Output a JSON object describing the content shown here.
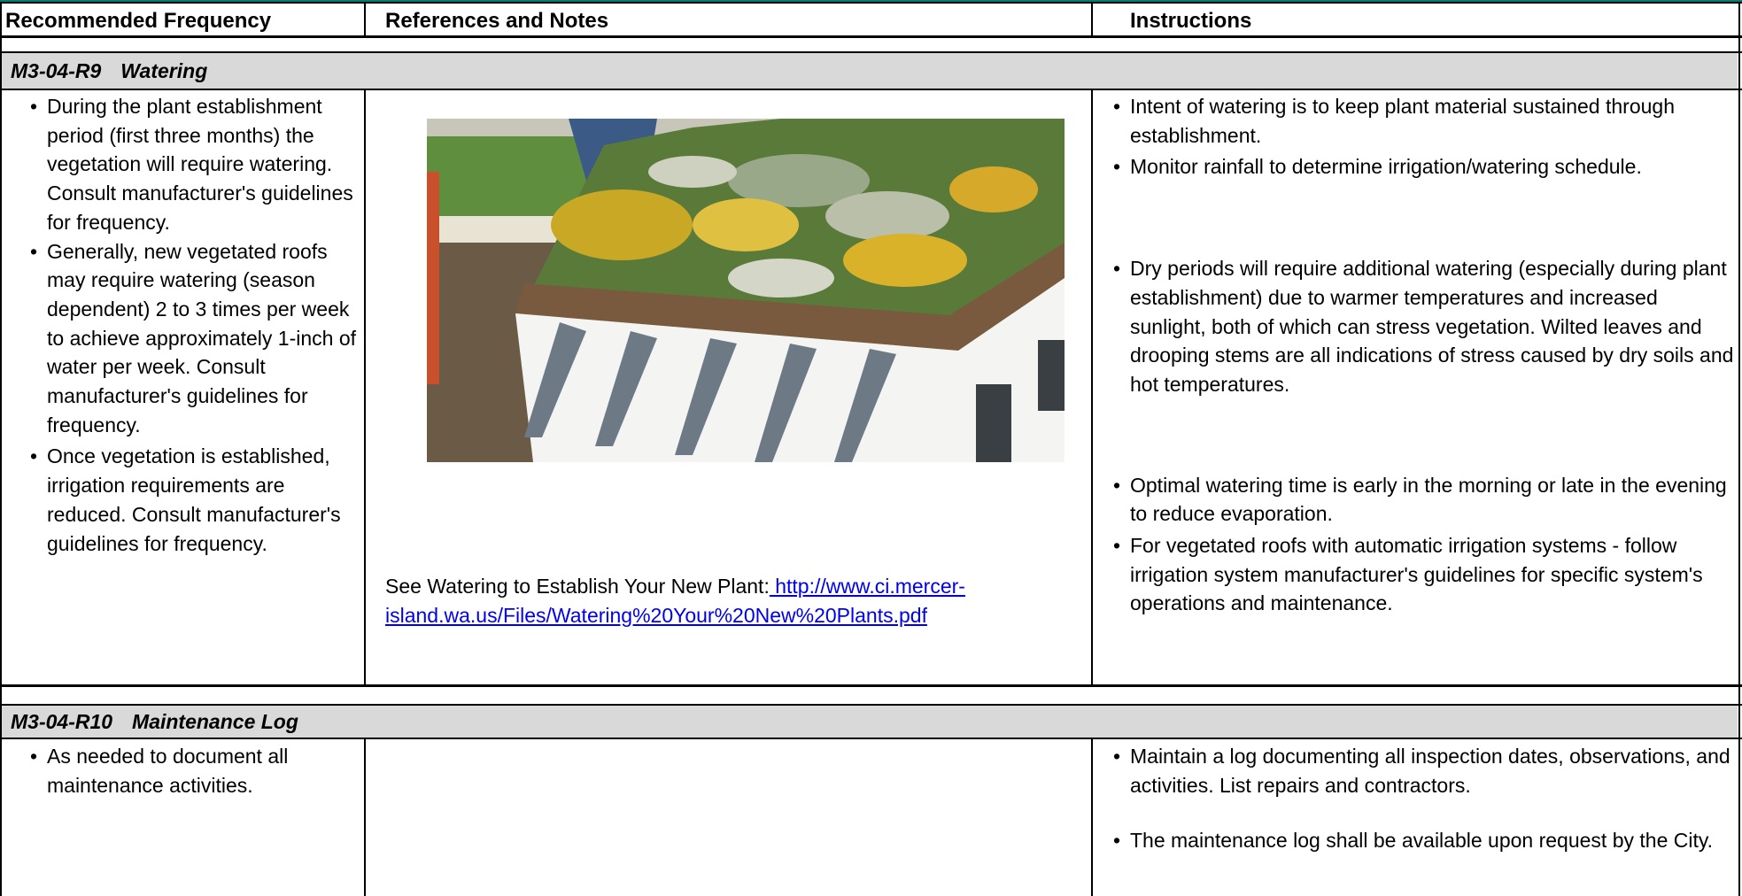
{
  "header": {
    "col1": "Recommended Frequency",
    "col2": "References and Notes",
    "col3": "Instructions"
  },
  "sections": [
    {
      "code": "M3-04-R9",
      "title": "Watering",
      "frequency": [
        "During the plant establishment period (first three months) the vegetation will require watering. Consult manufacturer's guidelines for frequency.",
        "Generally, new vegetated roofs may require watering (season dependent) 2 to 3 times per week to achieve approximately 1-inch of water per week. Consult manufacturer's guidelines for frequency.",
        "Once vegetation is established, irrigation requirements are reduced. Consult manufacturer's guidelines for frequency."
      ],
      "reference_text": "See Watering to Establish Your New Plant:",
      "reference_link": " http://www.ci.mercer-island.wa.us/Files/Watering%20Your%20New%20Plants.pdf",
      "instructions": [
        "Intent of watering is to keep plant material sustained through establishment.",
        "Monitor rainfall to determine irrigation/watering schedule.",
        "Dry periods will require additional watering (especially during plant establishment) due to warmer temperatures and increased sunlight, both of which can stress vegetation. Wilted leaves and drooping stems are all indications of stress caused by dry soils and hot temperatures.",
        "Optimal watering time is early in the morning or late in the evening to reduce evaporation.",
        "For vegetated roofs with automatic irrigation systems - follow irrigation system manufacturer's guidelines for specific system's operations and maintenance."
      ]
    },
    {
      "code": "M3-04-R10",
      "title": "Maintenance Log",
      "frequency": [
        "As needed to document all maintenance activities."
      ],
      "instructions": [
        "Maintain a log documenting all inspection dates, observations, and activities. List repairs and contractors.",
        "The maintenance log shall be available upon request by the City."
      ]
    }
  ]
}
